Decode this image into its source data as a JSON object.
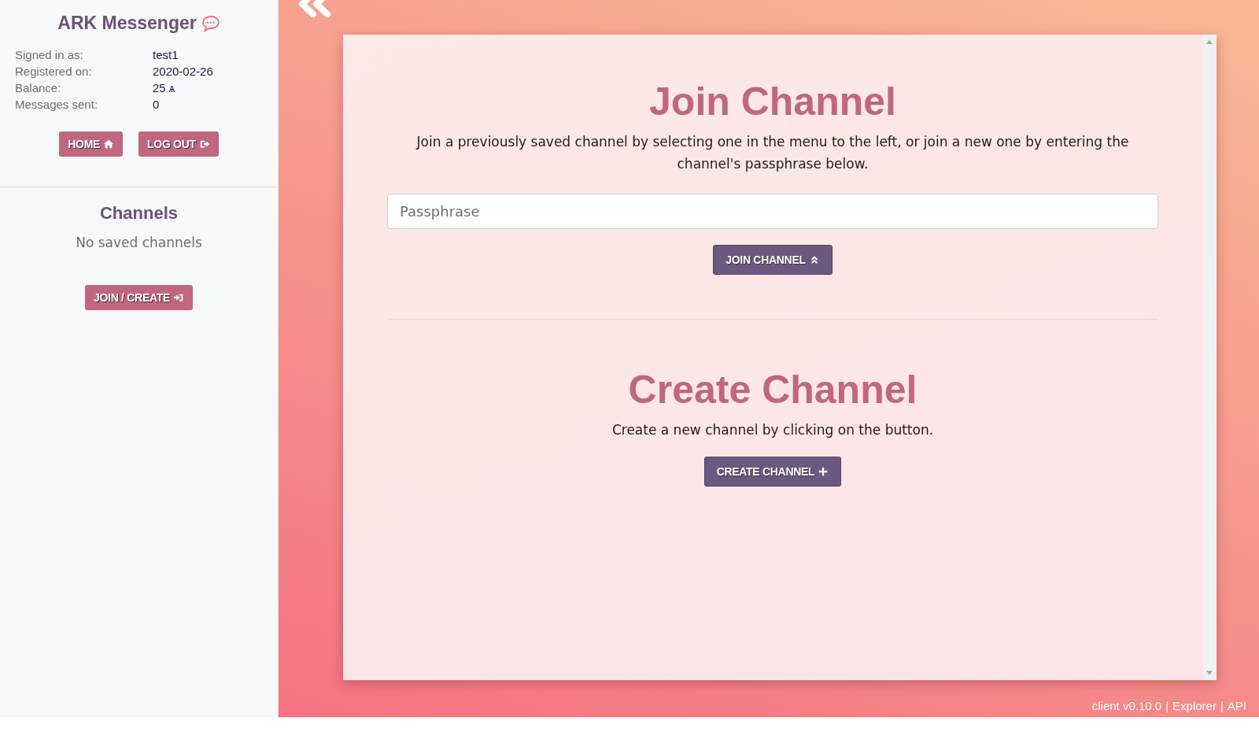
{
  "sidebar": {
    "title": "ARK Messenger",
    "info": [
      {
        "label": "Signed in as:",
        "value": "test1"
      },
      {
        "label": "Registered on:",
        "value": "2020-02-26"
      },
      {
        "label": "Balance:",
        "value": "25 ѧ"
      },
      {
        "label": "Messages sent:",
        "value": "0"
      }
    ],
    "buttons": [
      {
        "label": "HOME"
      },
      {
        "label": "LOG OUT"
      }
    ],
    "channels": {
      "title": "Channels",
      "empty": "No saved channels",
      "button": {
        "label": "JOIN / CREATE"
      }
    }
  },
  "join": {
    "title": "Join Channel",
    "text": "Join a previously saved channel by selecting one in the menu to the left, or join a new one by entering the channel's passphrase below.",
    "placeholder": "Passphrase",
    "button": {
      "label": "JOIN CHANNEL"
    }
  },
  "create": {
    "title": "Create Channel",
    "text": "Create a new channel by clicking on the button.",
    "button": {
      "label": "CREATE CHANNEL"
    }
  },
  "footer": [
    "client v0.10.0",
    "|",
    "Explorer",
    "|",
    "API"
  ]
}
